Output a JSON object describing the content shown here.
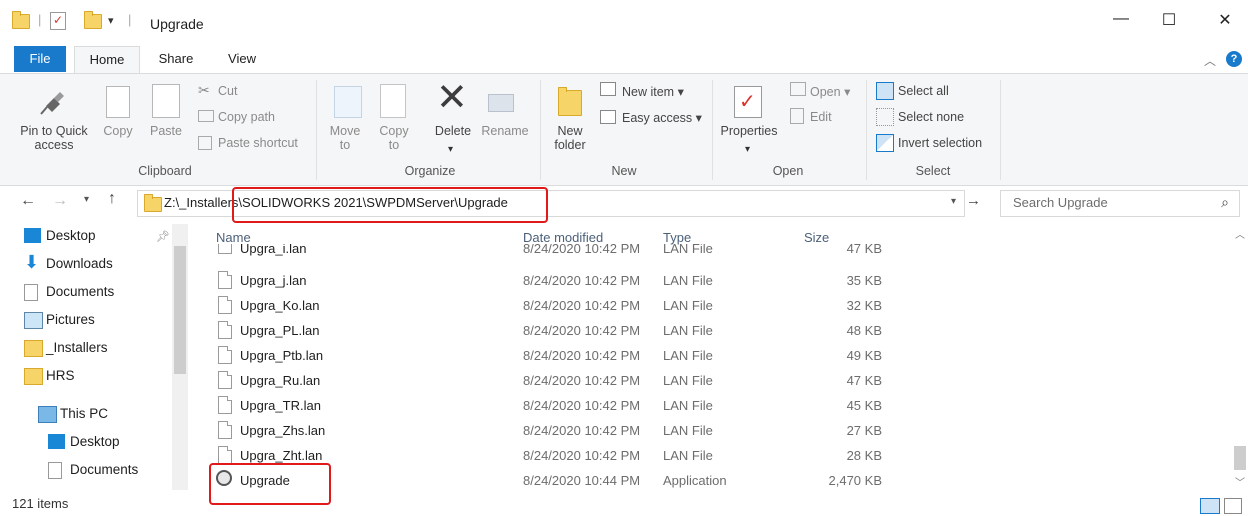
{
  "window": {
    "title": "Upgrade",
    "minimize": "—",
    "maximize": "☐",
    "close": "✕"
  },
  "tabs": [
    {
      "label": "File"
    },
    {
      "label": "Home"
    },
    {
      "label": "Share"
    },
    {
      "label": "View"
    }
  ],
  "ribbon": {
    "clipboard": {
      "pin": "Pin to Quick access",
      "copy": "Copy",
      "paste": "Paste",
      "cut": "Cut",
      "copy_path": "Copy path",
      "paste_shortcut": "Paste shortcut",
      "group": "Clipboard"
    },
    "organize": {
      "move_to": "Move to",
      "copy_to": "Copy to",
      "delete": "Delete",
      "rename": "Rename",
      "group": "Organize"
    },
    "new": {
      "new_folder": "New folder",
      "new_item": "New item",
      "easy_access": "Easy access",
      "group": "New"
    },
    "open": {
      "properties": "Properties",
      "open": "Open",
      "edit": "Edit",
      "group": "Open"
    },
    "select": {
      "select_all": "Select all",
      "select_none": "Select none",
      "invert_selection": "Invert selection",
      "group": "Select"
    }
  },
  "address": {
    "path": "Z:\\_Installers\\SOLIDWORKS 2021\\SWPDMServer\\Upgrade",
    "search_placeholder": "Search Upgrade"
  },
  "nav": {
    "quick_access": [
      "Desktop",
      "Downloads",
      "Documents",
      "Pictures",
      "_Installers",
      "HRS"
    ],
    "this_pc": "This PC",
    "pc_items": [
      "Desktop",
      "Documents"
    ]
  },
  "columns": {
    "name": "Name",
    "date": "Date modified",
    "type": "Type",
    "size": "Size"
  },
  "files": [
    {
      "name": "Upgra_i.lan",
      "date": "8/24/2020 10:42 PM",
      "type": "LAN File",
      "size": "47 KB"
    },
    {
      "name": "Upgra_j.lan",
      "date": "8/24/2020 10:42 PM",
      "type": "LAN File",
      "size": "35 KB"
    },
    {
      "name": "Upgra_Ko.lan",
      "date": "8/24/2020 10:42 PM",
      "type": "LAN File",
      "size": "32 KB"
    },
    {
      "name": "Upgra_PL.lan",
      "date": "8/24/2020 10:42 PM",
      "type": "LAN File",
      "size": "48 KB"
    },
    {
      "name": "Upgra_Ptb.lan",
      "date": "8/24/2020 10:42 PM",
      "type": "LAN File",
      "size": "49 KB"
    },
    {
      "name": "Upgra_Ru.lan",
      "date": "8/24/2020 10:42 PM",
      "type": "LAN File",
      "size": "47 KB"
    },
    {
      "name": "Upgra_TR.lan",
      "date": "8/24/2020 10:42 PM",
      "type": "LAN File",
      "size": "45 KB"
    },
    {
      "name": "Upgra_Zhs.lan",
      "date": "8/24/2020 10:42 PM",
      "type": "LAN File",
      "size": "27 KB"
    },
    {
      "name": "Upgra_Zht.lan",
      "date": "8/24/2020 10:42 PM",
      "type": "LAN File",
      "size": "28 KB"
    },
    {
      "name": "Upgrade",
      "date": "8/24/2020 10:44 PM",
      "type": "Application",
      "size": "2,470 KB"
    }
  ],
  "status": {
    "items": "121 items"
  },
  "colors": {
    "accent": "#1979ca",
    "highlight": "#e0191b",
    "folder": "#f7d468"
  }
}
